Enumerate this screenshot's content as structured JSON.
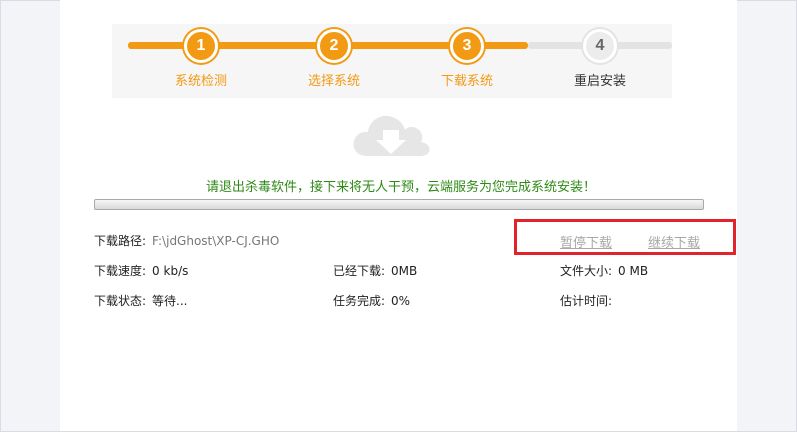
{
  "steps": [
    {
      "num": "1",
      "label": "系统检测"
    },
    {
      "num": "2",
      "label": "选择系统"
    },
    {
      "num": "3",
      "label": "下载系统"
    },
    {
      "num": "4",
      "label": "重启安装"
    }
  ],
  "current_step": 3,
  "message": "请退出杀毒软件，接下来将无人干预，云端服务为您完成系统安装！",
  "progress_percent": 0,
  "colors": {
    "accent": "#f39a14",
    "message": "#2f8a16",
    "highlight": "#e2232c"
  },
  "info": {
    "path_label": "下载路径:",
    "path_value": "F:\\jdGhost\\XP-CJ.GHO",
    "speed_label": "下载速度:",
    "speed_value": "0 kb/s",
    "downloaded_label": "已经下载:",
    "downloaded_value": "0MB",
    "size_label": "文件大小:",
    "size_value": "0 MB",
    "status_label": "下载状态:",
    "status_value": "等待...",
    "task_label": "任务完成:",
    "task_value": "0%",
    "eta_label": "估计时间:",
    "eta_value": ""
  },
  "buttons": {
    "pause": "暂停下载",
    "resume": "继续下载"
  },
  "icons": {
    "cloud": "cloud-download-icon"
  }
}
